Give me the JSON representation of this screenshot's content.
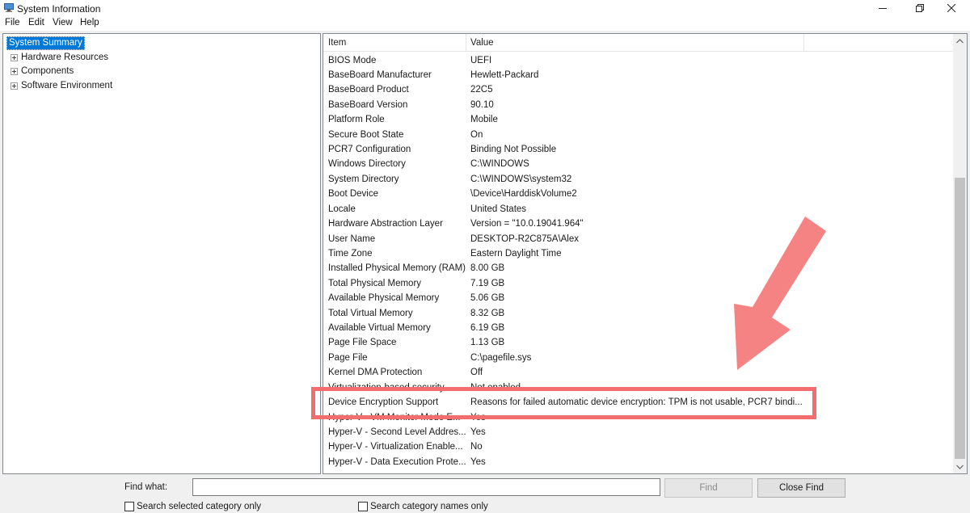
{
  "window": {
    "title": "System Information",
    "minimize_icon": "minimize-icon",
    "maximize_icon": "restore-icon",
    "close_icon": "close-icon"
  },
  "menu": [
    "File",
    "Edit",
    "View",
    "Help"
  ],
  "tree": {
    "root": "System Summary",
    "children": [
      "Hardware Resources",
      "Components",
      "Software Environment"
    ]
  },
  "table": {
    "columns": [
      "Item",
      "Value"
    ],
    "rows": [
      [
        "BIOS Mode",
        "UEFI"
      ],
      [
        "BaseBoard Manufacturer",
        "Hewlett-Packard"
      ],
      [
        "BaseBoard Product",
        "22C5"
      ],
      [
        "BaseBoard Version",
        "90.10"
      ],
      [
        "Platform Role",
        "Mobile"
      ],
      [
        "Secure Boot State",
        "On"
      ],
      [
        "PCR7 Configuration",
        "Binding Not Possible"
      ],
      [
        "Windows Directory",
        "C:\\WINDOWS"
      ],
      [
        "System Directory",
        "C:\\WINDOWS\\system32"
      ],
      [
        "Boot Device",
        "\\Device\\HarddiskVolume2"
      ],
      [
        "Locale",
        "United States"
      ],
      [
        "Hardware Abstraction Layer",
        "Version = \"10.0.19041.964\""
      ],
      [
        "User Name",
        "DESKTOP-R2C875A\\Alex"
      ],
      [
        "Time Zone",
        "Eastern Daylight Time"
      ],
      [
        "Installed Physical Memory (RAM)",
        "8.00 GB"
      ],
      [
        "Total Physical Memory",
        "7.19 GB"
      ],
      [
        "Available Physical Memory",
        "5.06 GB"
      ],
      [
        "Total Virtual Memory",
        "8.32 GB"
      ],
      [
        "Available Virtual Memory",
        "6.19 GB"
      ],
      [
        "Page File Space",
        "1.13 GB"
      ],
      [
        "Page File",
        "C:\\pagefile.sys"
      ],
      [
        "Kernel DMA Protection",
        "Off"
      ],
      [
        "Virtualization-based security",
        "Not enabled"
      ],
      [
        "Device Encryption Support",
        "Reasons for failed automatic device encryption: TPM is not usable, PCR7 bindi..."
      ],
      [
        "Hyper-V - VM Monitor Mode E...",
        "Yes"
      ],
      [
        "Hyper-V - Second Level Addres...",
        "Yes"
      ],
      [
        "Hyper-V - Virtualization Enable...",
        "No"
      ],
      [
        "Hyper-V - Data Execution Prote...",
        "Yes"
      ]
    ]
  },
  "find": {
    "label": "Find what:",
    "value": "",
    "find_button": "Find",
    "close_button": "Close Find",
    "check_selected": "Search selected category only",
    "check_names": "Search category names only"
  },
  "colors": {
    "selection": "#0078d7",
    "annotation": "#f36d6f"
  }
}
